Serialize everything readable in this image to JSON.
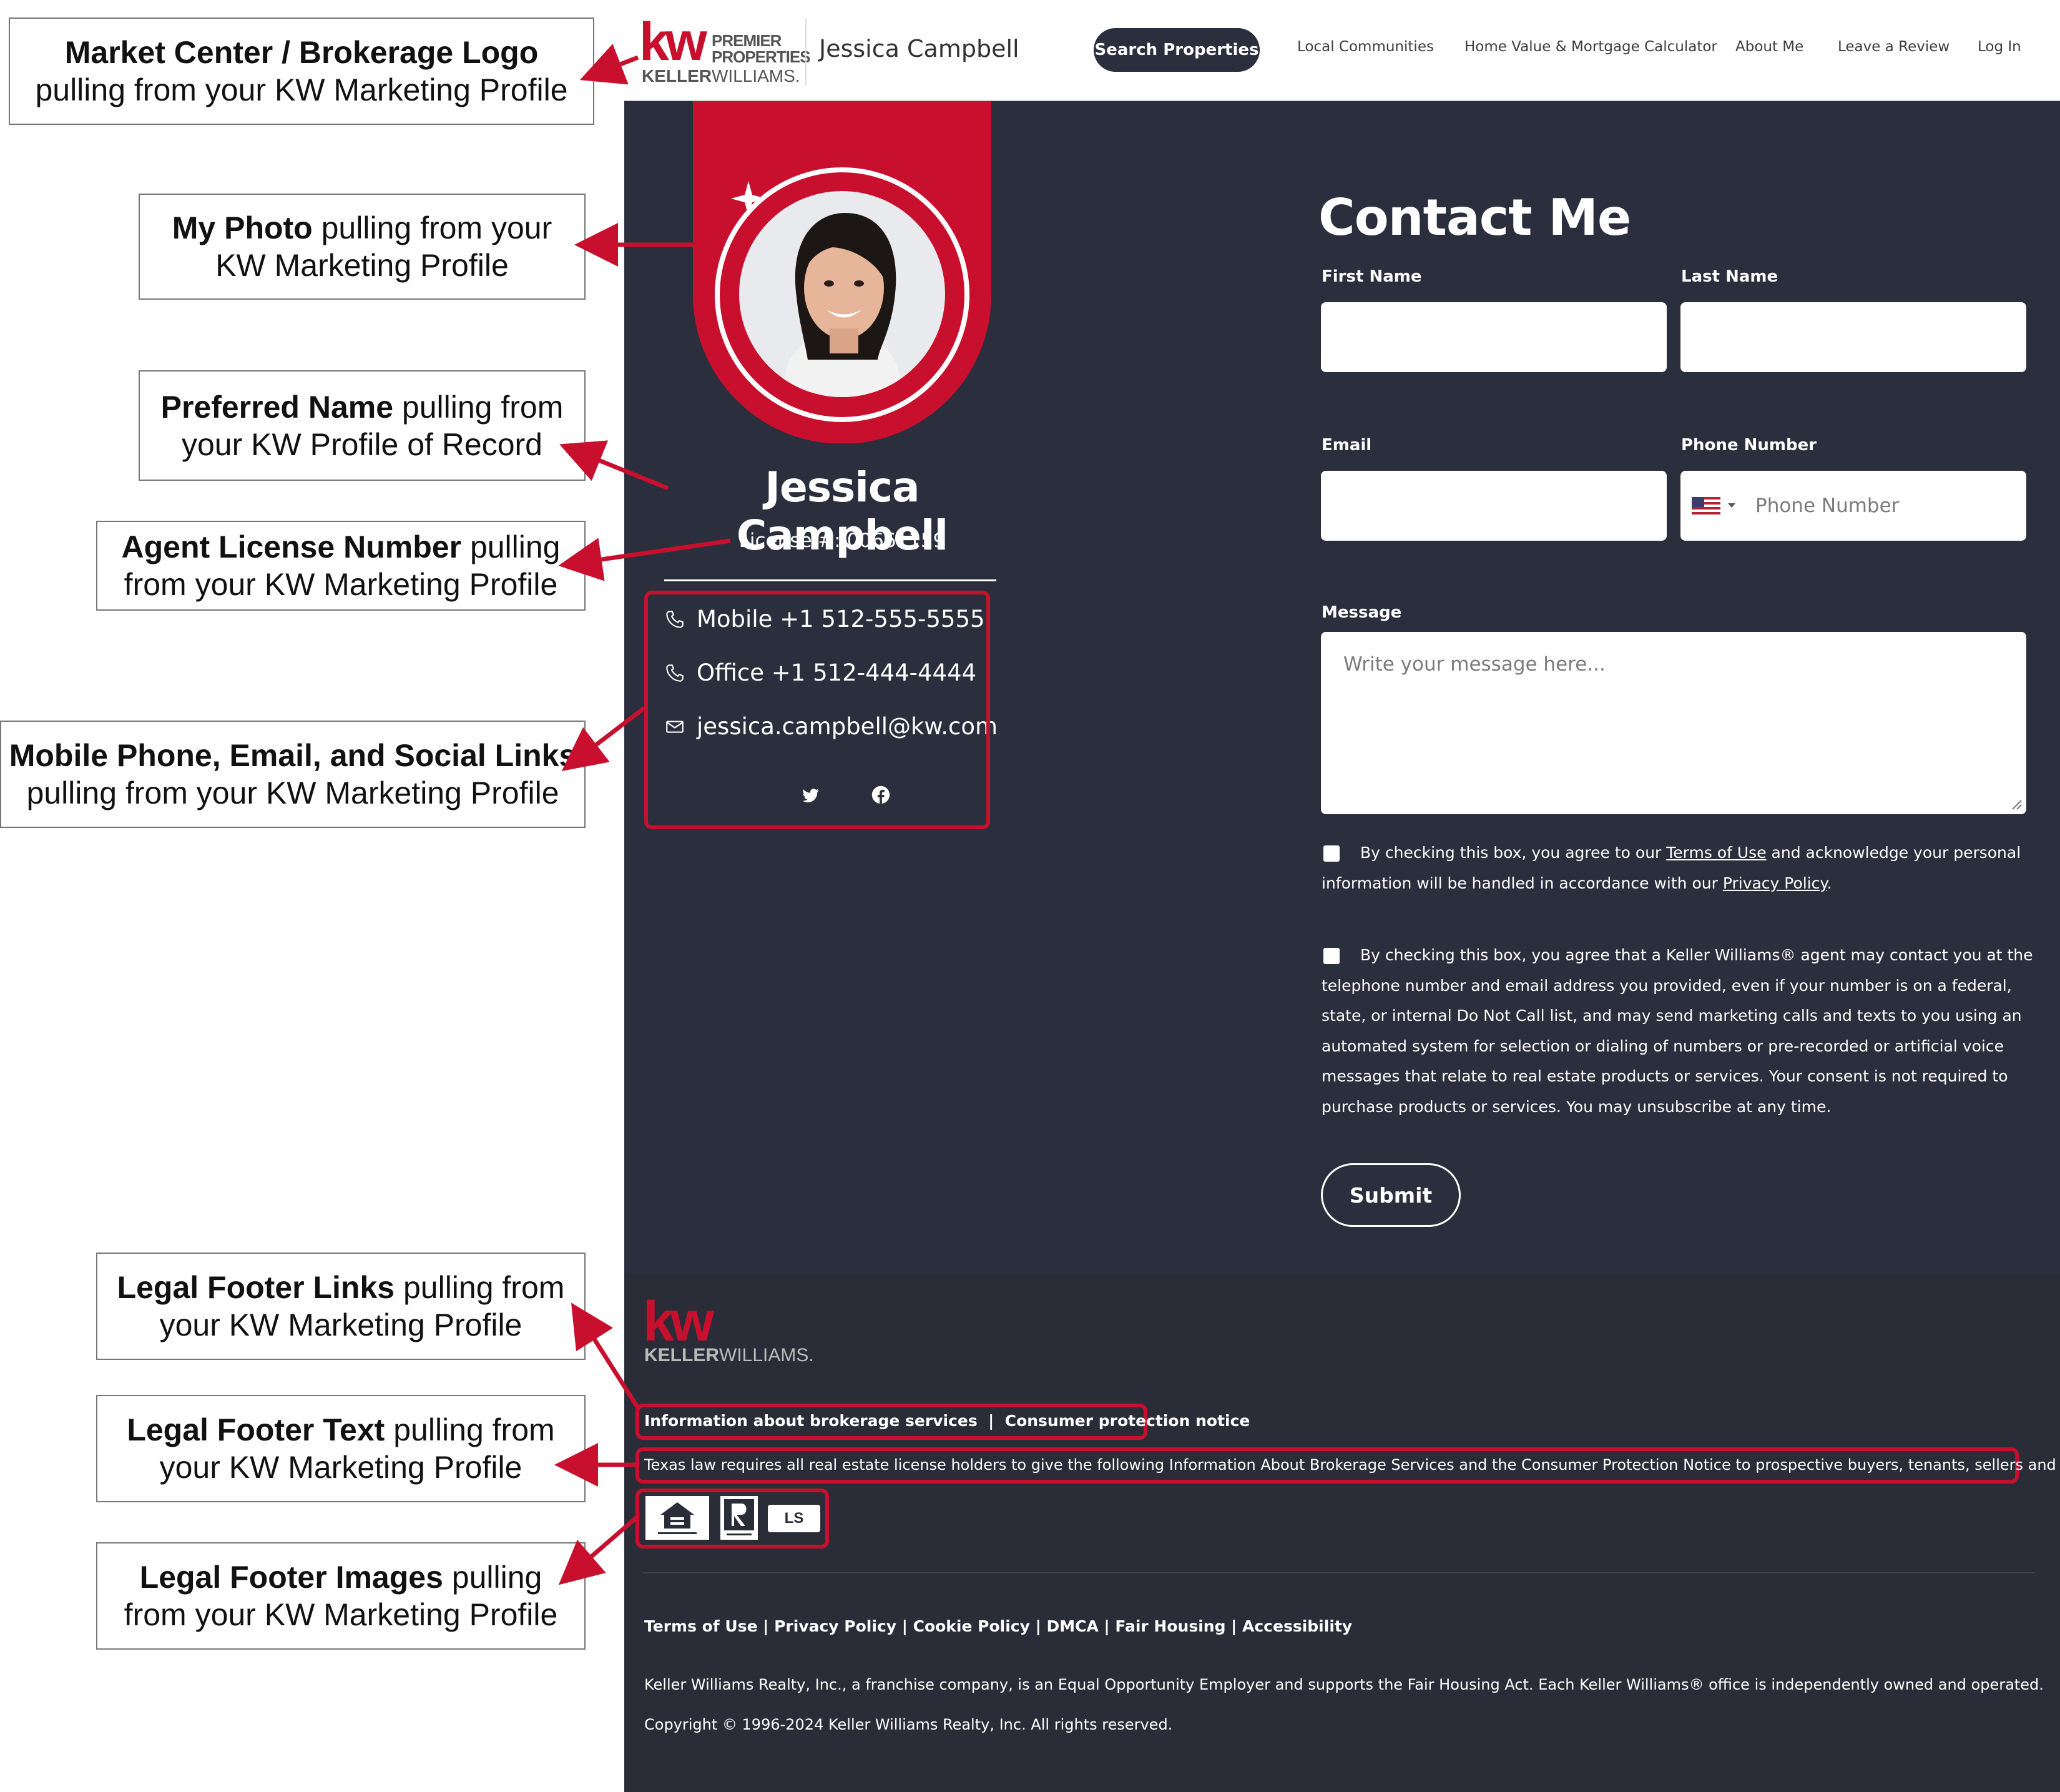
{
  "annotations": [
    {
      "bold": "Market Center / Brokerage Logo",
      "rest": "pulling from your KW Marketing Profile"
    },
    {
      "bold": "My Photo",
      "rest": " pulling from your KW Marketing Profile"
    },
    {
      "bold": "Preferred Name",
      "rest": " pulling from your KW Profile of Record"
    },
    {
      "bold": "Agent License Number",
      "rest": " pulling from your KW Marketing Profile"
    },
    {
      "bold": "Mobile Phone, Email, and Social Links",
      "rest": "pulling from your KW Marketing Profile"
    },
    {
      "bold": "Legal Footer Links",
      "rest": " pulling from your KW Marketing Profile"
    },
    {
      "bold": "Legal Footer Text",
      "rest": " pulling from your KW Marketing Profile"
    },
    {
      "bold": "Legal Footer Images",
      "rest": " pulling from your KW Marketing Profile"
    }
  ],
  "header": {
    "logo_kw": "kw",
    "logo_premier": "PREMIER",
    "logo_properties": "PROPERTIES",
    "logo_keller": "KELLER",
    "logo_williams": "WILLIAMS.",
    "agent_name": "Jessica Campbell",
    "nav": [
      "Search Properties",
      "Local Communities",
      "Home Value & Mortgage Calculator",
      "About Me",
      "Leave a Review",
      "Log In"
    ]
  },
  "profile": {
    "name": "Jessica Campbell",
    "license": "License #: 00661159",
    "mobile": "Mobile +1 512-555-5555",
    "office": "Office +1 512-444-4444",
    "email": "jessica.campbell@kw.com",
    "social_icons": [
      "twitter-icon",
      "facebook-icon"
    ]
  },
  "form": {
    "title": "Contact Me",
    "first_name_label": "First Name",
    "last_name_label": "Last Name",
    "email_label": "Email",
    "phone_label": "Phone Number",
    "phone_placeholder": "Phone Number",
    "message_label": "Message",
    "message_placeholder": "Write your message here...",
    "consent1_a": "By checking this box, you agree to our ",
    "consent1_terms": "Terms of Use",
    "consent1_b": " and acknowledge your personal information will be handled in accordance with our ",
    "consent1_privacy": "Privacy Policy",
    "consent1_c": ".",
    "consent2": "By checking this box, you agree that a Keller Williams® agent may contact you at the telephone number and email address you provided, even if your number is on a federal, state, or internal Do Not Call list, and may send marketing calls and texts to you using an automated system for selection or dialing of numbers or pre-recorded or artificial voice messages that relate to real estate products or services. Your consent is not required to purchase products or services. You may unsubscribe at any time.",
    "submit": "Submit"
  },
  "footer": {
    "logo_kw": "kw",
    "logo_keller": "KELLER",
    "logo_williams": "WILLIAMS.",
    "legal_link_1": "Information about brokerage services",
    "legal_link_sep": "|",
    "legal_link_2": "Consumer protection notice",
    "legal_text": "Texas law requires all real estate license holders to give the following Information About Brokerage Services and the Consumer Protection Notice to prospective buyers, tenants, sellers and landlords.",
    "legal_images": [
      "equal-housing-icon",
      "realtor-icon",
      "mls-icon"
    ],
    "mls_text": "LS",
    "links": [
      "Terms of Use",
      "Privacy Policy",
      "Cookie Policy",
      "DMCA",
      "Fair Housing",
      "Accessibility"
    ],
    "statement": "Keller Williams Realty, Inc., a franchise company, is an Equal Opportunity Employer and supports the Fair Housing Act. Each Keller Williams® office is independently owned and operated.",
    "copyright": "Copyright © 1996-2024 Keller Williams Realty, Inc. All rights reserved."
  },
  "colors": {
    "brand_red": "#c8102e",
    "dark_bg": "#2b2e3d",
    "footer_bg": "#2a2d38"
  }
}
